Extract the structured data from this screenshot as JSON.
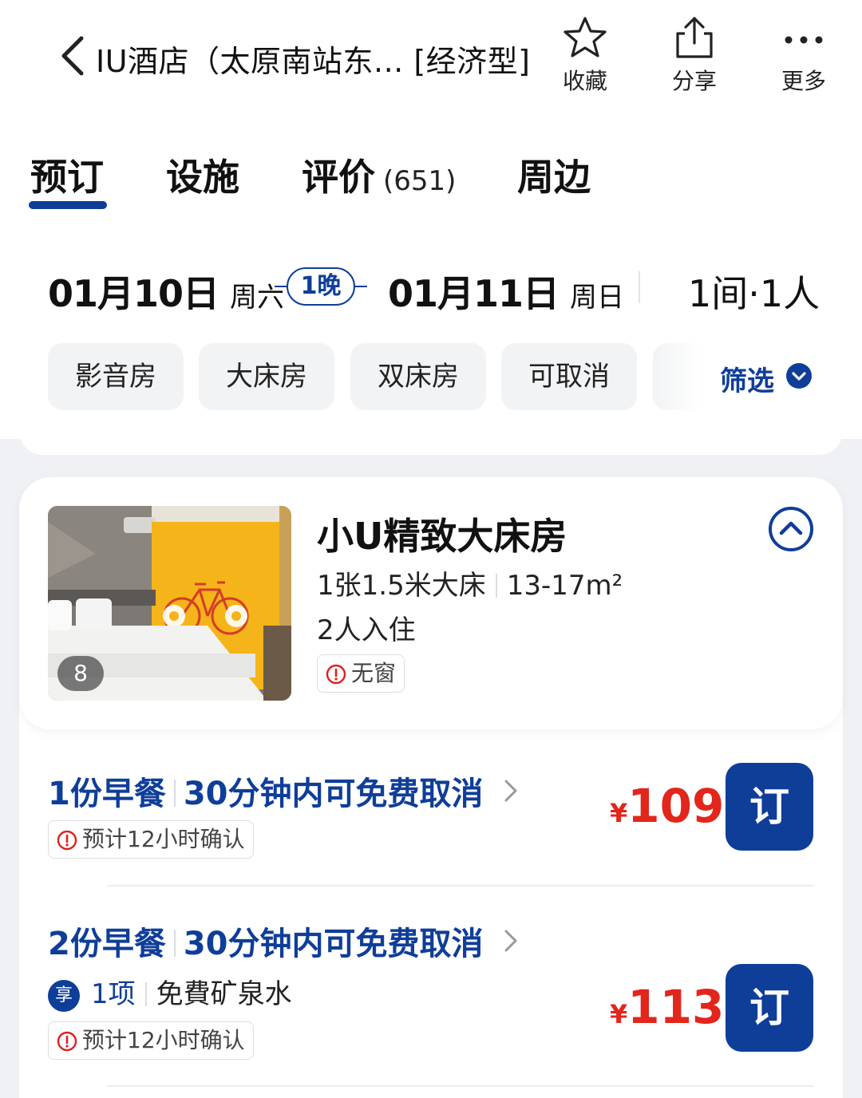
{
  "header": {
    "title": "IU酒店（太原南站东...  [经济型]",
    "favorite_label": "收藏",
    "share_label": "分享",
    "more_label": "更多"
  },
  "tabs": [
    {
      "label": "预订",
      "active": true
    },
    {
      "label": "设施"
    },
    {
      "label": "评价",
      "count": "(651)"
    },
    {
      "label": "周边"
    }
  ],
  "stay": {
    "checkin_date": "01月10日",
    "checkin_weekday": "周六",
    "nights": "1晚",
    "checkout_date": "01月11日",
    "checkout_weekday": "周日",
    "rooms_guests": "1间·1人"
  },
  "filters": {
    "chips": [
      "影音房",
      "大床房",
      "双床房",
      "可取消"
    ],
    "filter_label": "筛选"
  },
  "room": {
    "name": "小U精致大床房",
    "bed": "1张1.5米大床",
    "area": "13-17m²",
    "occupancy": "2人入住",
    "tag": "无窗",
    "photo_count": "8",
    "rates": [
      {
        "breakfast": "1份早餐",
        "cancel": "30分钟内可免费取消",
        "confirm": "预计12小时确认",
        "currency": "¥",
        "price": "109",
        "book_label": "订"
      },
      {
        "breakfast": "2份早餐",
        "cancel": "30分钟内可免费取消",
        "perk_badge": "享",
        "perk_count": "1项",
        "perk_item": "免費矿泉水",
        "confirm": "预计12小时确认",
        "currency": "¥",
        "price": "113",
        "book_label": "订"
      }
    ]
  },
  "colors": {
    "brand_blue": "#0f3e99",
    "price_red": "#e2261c",
    "warn_red": "#e02020",
    "page_bg": "#eff1f5"
  }
}
